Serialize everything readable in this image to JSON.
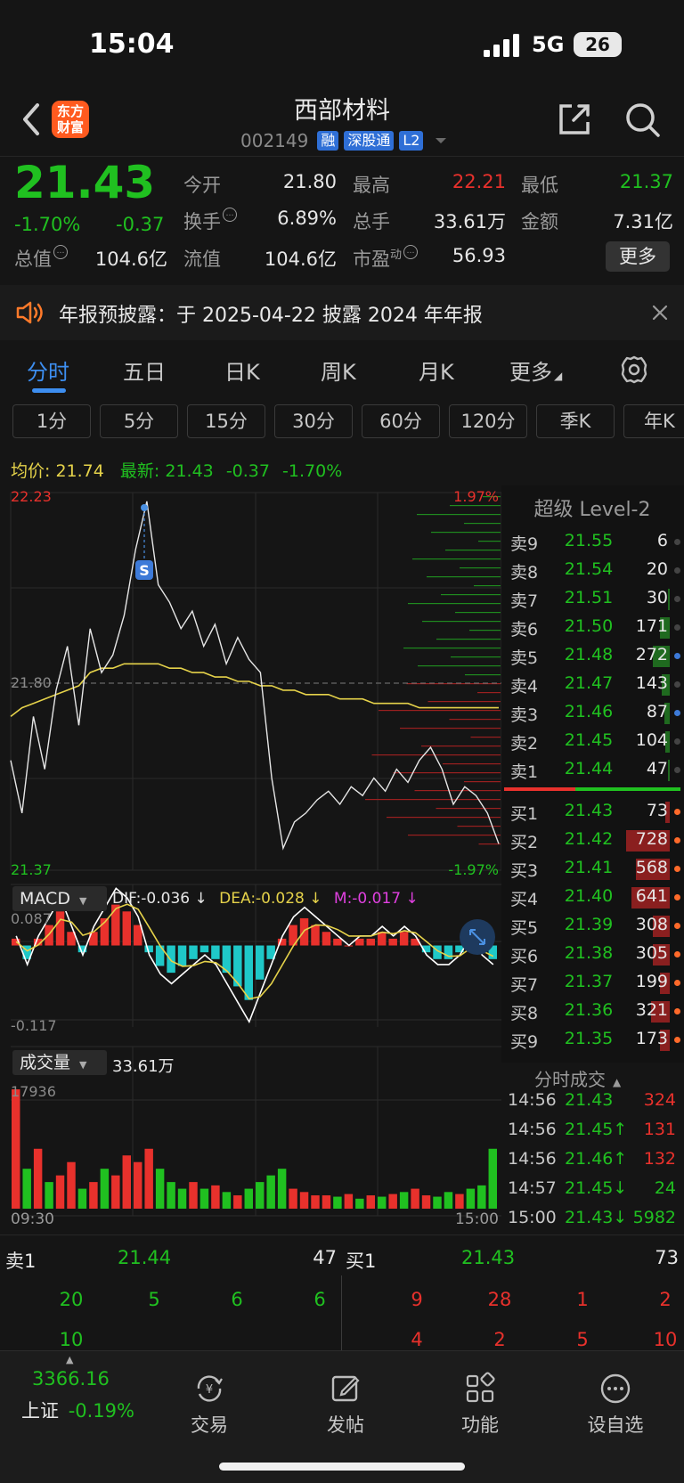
{
  "status_bar": {
    "time": "15:04",
    "network": "5G",
    "battery": "26"
  },
  "header": {
    "logo_line1": "东方",
    "logo_line2": "财富",
    "stock_name": "西部材料",
    "stock_code": "002149",
    "tags": [
      "融",
      "深股通",
      "L2"
    ]
  },
  "quote": {
    "price": "21.43",
    "change_pct": "-1.70%",
    "change": "-0.37",
    "fields": [
      {
        "label": "今开",
        "value": "21.80",
        "color": "white"
      },
      {
        "label": "最高",
        "value": "22.21",
        "color": "red"
      },
      {
        "label": "最低",
        "value": "21.37",
        "color": "green"
      },
      {
        "label": "换手",
        "value": "6.89%",
        "color": "white"
      },
      {
        "label": "总手",
        "value": "33.61万",
        "color": "white"
      },
      {
        "label": "金额",
        "value": "7.31亿",
        "color": "white"
      },
      {
        "label": "总值",
        "value": "104.6亿",
        "color": "white"
      },
      {
        "label": "流值",
        "value": "104.6亿",
        "color": "white"
      },
      {
        "label": "市盈",
        "value": "56.93",
        "color": "white"
      }
    ],
    "pe_sup": "动",
    "more_label": "更多"
  },
  "notice": {
    "text": "年报预披露：于 2025-04-22 披露 2024 年年报"
  },
  "tabs": [
    "分时",
    "五日",
    "日K",
    "周K",
    "月K",
    "更多"
  ],
  "periods": [
    "1分",
    "5分",
    "15分",
    "30分",
    "60分",
    "120分",
    "季K",
    "年K"
  ],
  "chart_header": {
    "avg_label": "均价:",
    "avg_value": "21.74",
    "last_label": "最新:",
    "last_value": "21.43",
    "last_change": "-0.37",
    "last_pct": "-1.70%"
  },
  "chart_labels": {
    "top_price": "22.23",
    "top_pct": "1.97%",
    "mid_price": "21.80",
    "bottom_price": "21.37",
    "bottom_pct": "-1.97%",
    "macd_top": "0.087",
    "macd_bottom": "-0.117",
    "vol_top": "17936",
    "time_start": "09:30",
    "time_end": "15:00",
    "signal_marker": "S"
  },
  "macd": {
    "name": "MACD",
    "dif": "DIF:-0.036 ↓",
    "dea": "DEA:-0.028 ↓",
    "m": "M:-0.017 ↓"
  },
  "volume": {
    "name": "成交量",
    "total": "33.61万"
  },
  "order_book": {
    "title": "超级 Level-2",
    "asks": [
      {
        "label": "卖9",
        "price": "21.55",
        "vol": "6",
        "bar": 0.0
      },
      {
        "label": "卖8",
        "price": "21.54",
        "vol": "20",
        "bar": 0.0
      },
      {
        "label": "卖7",
        "price": "21.51",
        "vol": "30",
        "bar": 0.02
      },
      {
        "label": "卖6",
        "price": "21.50",
        "vol": "171",
        "bar": 0.15
      },
      {
        "label": "卖5",
        "price": "21.48",
        "vol": "272",
        "bar": 0.25
      },
      {
        "label": "卖4",
        "price": "21.47",
        "vol": "143",
        "bar": 0.12
      },
      {
        "label": "卖3",
        "price": "21.46",
        "vol": "87",
        "bar": 0.08
      },
      {
        "label": "卖2",
        "price": "21.45",
        "vol": "104",
        "bar": 0.06
      },
      {
        "label": "卖1",
        "price": "21.44",
        "vol": "47",
        "bar": 0.03
      }
    ],
    "bids": [
      {
        "label": "买1",
        "price": "21.43",
        "vol": "73",
        "bar": 0.06
      },
      {
        "label": "买2",
        "price": "21.42",
        "vol": "728",
        "bar": 0.64
      },
      {
        "label": "买3",
        "price": "21.41",
        "vol": "568",
        "bar": 0.5
      },
      {
        "label": "买4",
        "price": "21.40",
        "vol": "641",
        "bar": 0.56
      },
      {
        "label": "买5",
        "price": "21.39",
        "vol": "308",
        "bar": 0.25
      },
      {
        "label": "买6",
        "price": "21.38",
        "vol": "305",
        "bar": 0.25
      },
      {
        "label": "买7",
        "price": "21.37",
        "vol": "199",
        "bar": 0.15
      },
      {
        "label": "买8",
        "price": "21.36",
        "vol": "321",
        "bar": 0.27
      },
      {
        "label": "买9",
        "price": "21.35",
        "vol": "173",
        "bar": 0.14
      }
    ]
  },
  "time_sales": {
    "title": "分时成交",
    "rows": [
      {
        "time": "14:56",
        "price": "21.43",
        "arrow": "",
        "vol": "324",
        "pcolor": "green",
        "vcolor": "red"
      },
      {
        "time": "14:56",
        "price": "21.45",
        "arrow": "↑",
        "vol": "131",
        "pcolor": "green",
        "vcolor": "red"
      },
      {
        "time": "14:56",
        "price": "21.46",
        "arrow": "↑",
        "vol": "132",
        "pcolor": "green",
        "vcolor": "red"
      },
      {
        "time": "14:57",
        "price": "21.45",
        "arrow": "↓",
        "vol": "24",
        "pcolor": "green",
        "vcolor": "green"
      },
      {
        "time": "15:00",
        "price": "21.43",
        "arrow": "↓",
        "vol": "5982",
        "pcolor": "green",
        "vcolor": "green"
      }
    ]
  },
  "bottom_strip": {
    "ask_label": "卖1",
    "ask_price": "21.44",
    "ask_vol": "47",
    "bid_label": "买1",
    "bid_price": "21.43",
    "bid_vol": "73",
    "ask_queue_row1": [
      "20",
      "5",
      "6",
      "6"
    ],
    "ask_queue_row2": [
      "10"
    ],
    "bid_queue_row1": [
      "9",
      "28",
      "1",
      "2"
    ],
    "bid_queue_row2": [
      "4",
      "2",
      "5",
      "10"
    ]
  },
  "bottom_nav": {
    "index_value": "3366.16",
    "index_name": "上证",
    "index_change": "-0.19%",
    "items": [
      "交易",
      "发帖",
      "功能",
      "设自选"
    ]
  },
  "chart_data": {
    "type": "line",
    "title": "",
    "x_range": [
      "09:30",
      "15:00"
    ],
    "ylim": [
      21.37,
      22.23
    ],
    "reference_price": 21.8,
    "series": [
      {
        "name": "",
        "color": "#e6e6e6",
        "values": [
          21.62,
          21.5,
          21.72,
          21.6,
          21.78,
          21.88,
          21.7,
          21.92,
          21.82,
          21.86,
          21.95,
          22.1,
          22.21,
          22.02,
          21.98,
          21.92,
          21.96,
          21.88,
          21.93,
          21.84,
          21.9,
          21.85,
          21.82,
          21.58,
          21.42,
          21.48,
          21.5,
          21.53,
          21.55,
          21.52,
          21.56,
          21.54,
          21.58,
          21.55,
          21.6,
          21.57,
          21.62,
          21.65,
          21.6,
          21.52,
          21.56,
          21.54,
          21.5,
          21.43
        ]
      },
      {
        "name": "",
        "color": "#e5d24a",
        "values": [
          21.72,
          21.74,
          21.75,
          21.76,
          21.77,
          21.78,
          21.79,
          21.82,
          21.83,
          21.83,
          21.84,
          21.84,
          21.84,
          21.84,
          21.83,
          21.83,
          21.82,
          21.82,
          21.81,
          21.81,
          21.8,
          21.8,
          21.79,
          21.79,
          21.78,
          21.78,
          21.77,
          21.77,
          21.77,
          21.76,
          21.76,
          21.76,
          21.75,
          21.75,
          21.75,
          21.75,
          21.74,
          21.74,
          21.74,
          21.74,
          21.74,
          21.74,
          21.74,
          21.74
        ]
      }
    ],
    "macd_ylim": [
      -0.117,
      0.087
    ],
    "macd_hist": [
      0.01,
      -0.02,
      0.01,
      0.03,
      0.05,
      0.02,
      -0.01,
      0.02,
      0.04,
      0.06,
      0.05,
      0.03,
      -0.01,
      -0.03,
      -0.04,
      -0.03,
      -0.02,
      -0.01,
      -0.02,
      -0.04,
      -0.06,
      -0.08,
      -0.05,
      -0.02,
      0.01,
      0.03,
      0.04,
      0.03,
      0.02,
      0.01,
      0.0,
      0.01,
      0.01,
      0.02,
      0.01,
      0.02,
      0.01,
      -0.01,
      -0.02,
      -0.02,
      -0.01,
      0.01,
      -0.01,
      -0.02
    ],
    "volume_max": 17936,
    "volume": [
      17936,
      6000,
      9000,
      4000,
      5000,
      7000,
      3000,
      4000,
      6000,
      5000,
      8000,
      7000,
      9000,
      6000,
      4000,
      3000,
      4000,
      3000,
      3500,
      2500,
      2000,
      3000,
      4000,
      5000,
      6000,
      3000,
      2500,
      2000,
      2000,
      1800,
      2200,
      1500,
      2000,
      1800,
      2200,
      2500,
      3000,
      2000,
      1800,
      2500,
      2200,
      3000,
      3500,
      9000
    ]
  }
}
